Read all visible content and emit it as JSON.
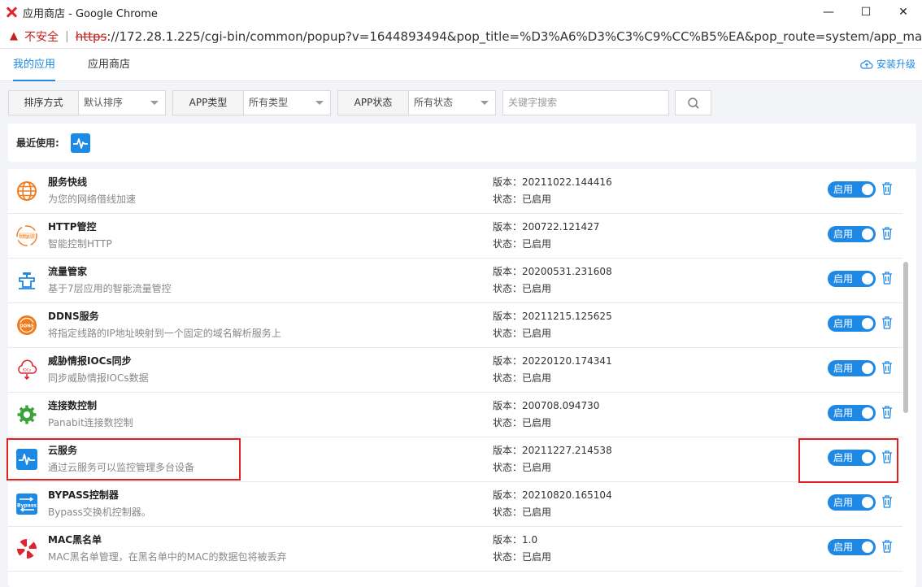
{
  "window": {
    "title": "应用商店 - Google Chrome",
    "minimize_glyph": "—",
    "maximize_glyph": "☐",
    "close_glyph": "✕"
  },
  "address": {
    "insecure": "不安全",
    "separator": "|",
    "scheme": "https",
    "url": "://172.28.1.225/cgi-bin/common/popup?v=1644893494&pop_title=%D3%A6%D3%C3%C9%CC%B5%EA&pop_route=system/app_main"
  },
  "tabs": [
    {
      "label": "我的应用",
      "active": true
    },
    {
      "label": "应用商店",
      "active": false
    }
  ],
  "install_label": "安装升级",
  "filters": {
    "sort": {
      "label": "排序方式",
      "value": "默认排序"
    },
    "type": {
      "label": "APP类型",
      "value": "所有类型"
    },
    "status": {
      "label": "APP状态",
      "value": "所有状态"
    },
    "search_placeholder": "关键字搜索"
  },
  "recent": {
    "label": "最近使用:"
  },
  "colors": {
    "accent": "#1e88e5",
    "danger": "#e02020",
    "orange": "#f07c1b"
  },
  "apps": [
    {
      "name": "服务快线",
      "desc": "为您的网络借线加速",
      "version": "版本：20211022.144416",
      "status": "状态：已启用",
      "toggle": "启用",
      "icon": "globe-icon"
    },
    {
      "name": "HTTP管控",
      "desc": "智能控制HTTP",
      "version": "版本：200722.121427",
      "status": "状态：已启用",
      "toggle": "启用",
      "icon": "http-icon",
      "icon_text": "http://"
    },
    {
      "name": "流量管家",
      "desc": "基于7层应用的智能流量管控",
      "version": "版本：20200531.231608",
      "status": "状态：已启用",
      "toggle": "启用",
      "icon": "faucet-icon"
    },
    {
      "name": "DDNS服务",
      "desc": "将指定线路的IP地址映射到一个固定的域名解析服务上",
      "version": "版本：20211215.125625",
      "status": "状态：已启用",
      "toggle": "启用",
      "icon": "ddns-icon",
      "icon_text": "DDNS"
    },
    {
      "name": "威胁情报IOCs同步",
      "desc": "同步威胁情报IOCs数据",
      "version": "版本：20220120.174341",
      "status": "状态：已启用",
      "toggle": "启用",
      "icon": "cloud-sync-icon",
      "icon_text": "IOCs"
    },
    {
      "name": "连接数控制",
      "desc": "Panabit连接数控制",
      "version": "版本：200708.094730",
      "status": "状态：已启用",
      "toggle": "启用",
      "icon": "gear-icon"
    },
    {
      "name": "云服务",
      "desc": "通过云服务可以监控管理多台设备",
      "version": "版本：20211227.214538",
      "status": "状态：已启用",
      "toggle": "启用",
      "icon": "pulse-icon"
    },
    {
      "name": "BYPASS控制器",
      "desc": "Bypass交换机控制器。",
      "version": "版本：20210820.165104",
      "status": "状态：已启用",
      "toggle": "启用",
      "icon": "bypass-icon",
      "icon_text": "Bypass"
    },
    {
      "name": "MAC黑名单",
      "desc": "MAC黑名单管理，在黑名单中的MAC的数据包将被丢弃",
      "version": "版本：1.0",
      "status": "状态：已启用",
      "toggle": "启用",
      "icon": "mac-block-icon"
    }
  ]
}
